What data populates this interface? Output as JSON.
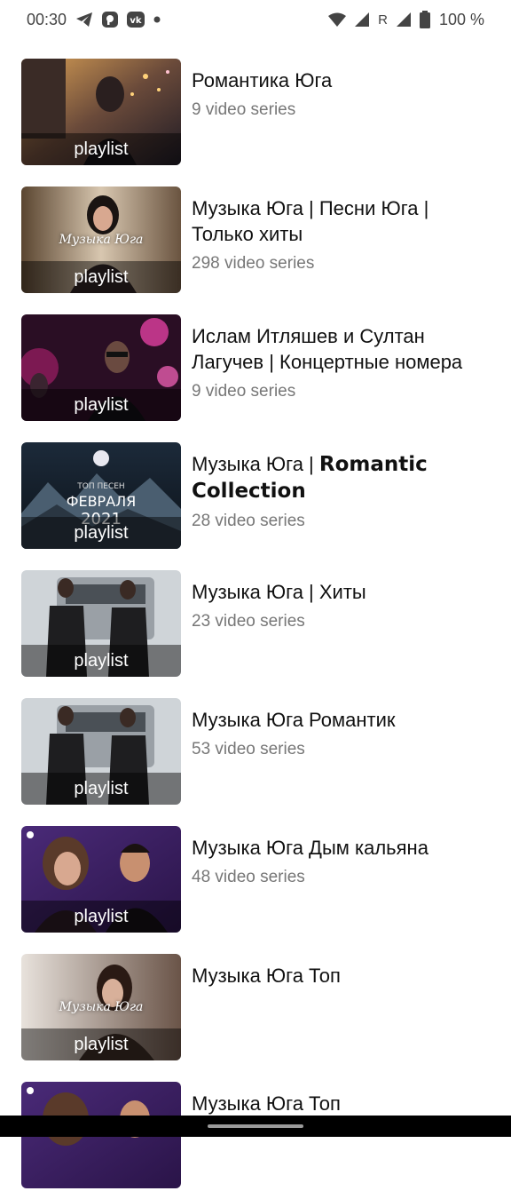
{
  "status_bar": {
    "time": "00:30",
    "icons_left": [
      "telegram-icon",
      "pinterest-like-icon",
      "vk-icon",
      "dot-icon"
    ],
    "icons_right": [
      "wifi-icon",
      "signal-icon",
      "roaming-indicator",
      "signal-icon-2",
      "battery-icon"
    ],
    "roaming": "R",
    "battery": "100 %"
  },
  "thumb_overlay_label": "playlist",
  "playlists": [
    {
      "title": "Романтика Юга",
      "count": "9 video series",
      "art": "night-street"
    },
    {
      "title": "Музыка Юга | Песни Юга | Только хиты",
      "count": "298 video series",
      "art": "portrait",
      "caption": "Музыка Юга"
    },
    {
      "title": "Ислам Итляшев и Султан Лагучев | Концертные номера",
      "count": "9 video series",
      "art": "concert"
    },
    {
      "title_part1": "Музыка Юга | ",
      "title_part2": "Romantic Collection",
      "count": "28 video series",
      "art": "mountains"
    },
    {
      "title": "Музыка Юга | Хиты",
      "count": "23 video series",
      "art": "snow-car"
    },
    {
      "title": "Музыка Юга Романтик",
      "count": "53 video series",
      "art": "snow-car"
    },
    {
      "title": "Музыка Юга Дым кальяна",
      "count": "48 video series",
      "art": "purple-duo"
    },
    {
      "title": "Музыка Юга Топ",
      "count": "",
      "art": "portrait-girl",
      "caption": "Музыка Юга"
    }
  ]
}
